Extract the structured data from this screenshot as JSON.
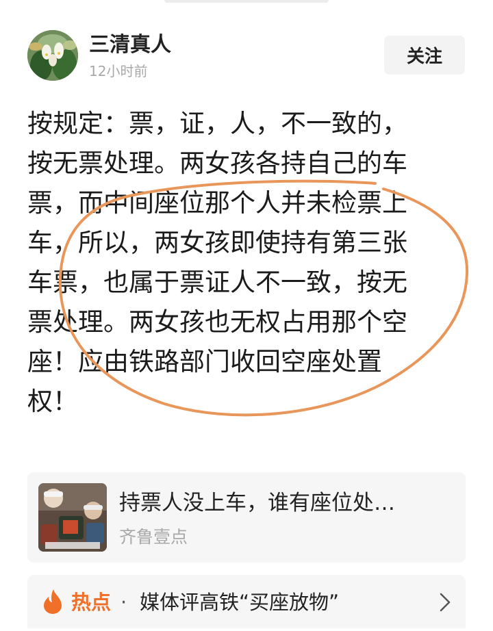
{
  "post": {
    "author": "三清真人",
    "time": "12小时前",
    "follow_label": "关注",
    "body_lines": [
      "按规定：票，证，人，不一致的，",
      "按无票处理。两女孩各持自己的车",
      "票，而中间座位那个人并未检票上",
      "车，所以，两女孩即使持有第三张",
      "车票，也属于票证人不一致，按无",
      "票处理。两女孩也无权占用那个空",
      "座！应由铁路部门收回空座处置",
      "权！"
    ],
    "highlight_color": "#e8965a"
  },
  "related_news": {
    "title": "持票人没上车，谁有座位处…",
    "source": "齐鲁壹点"
  },
  "hot_topic": {
    "label": "热点",
    "separator": "·",
    "text": "媒体评高铁“买座放物”",
    "accent_color": "#f0702a"
  }
}
